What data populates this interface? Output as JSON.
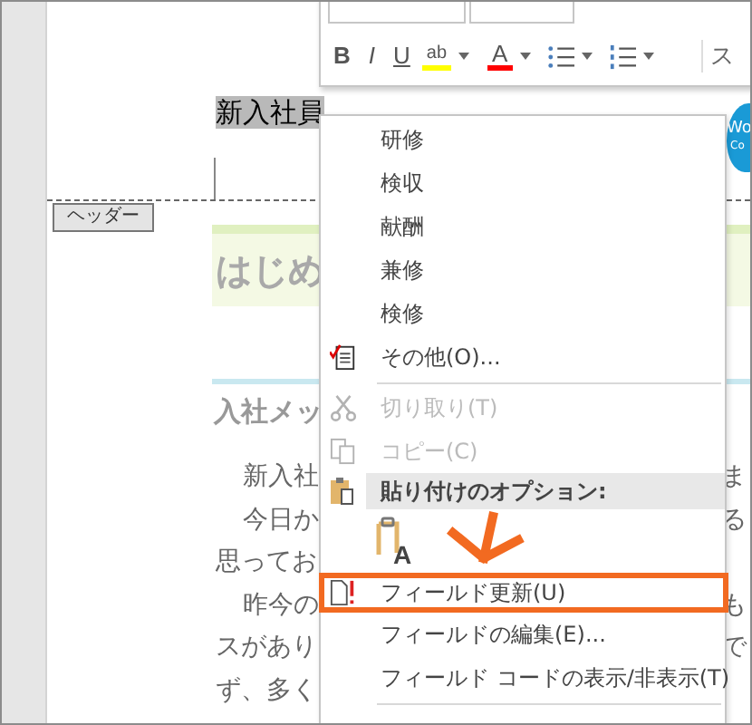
{
  "mini_toolbar": {
    "buttons": [
      {
        "kind": "bold",
        "label": "B"
      },
      {
        "kind": "italic",
        "label": "I"
      },
      {
        "kind": "underline",
        "label": "U"
      },
      {
        "kind": "highlight",
        "label": "ab"
      },
      {
        "kind": "font_color",
        "label": "A"
      },
      {
        "kind": "bullets"
      },
      {
        "kind": "numbering"
      }
    ],
    "right_text": "ス"
  },
  "document": {
    "title": [
      {
        "text": "新入社員",
        "selected": true
      }
    ],
    "header_tag": "ヘッダー",
    "banner": "はじめ",
    "section_heading": "入社メッ",
    "body_lines": [
      {
        "left": "新入社",
        "right": "ま",
        "indented": true
      },
      {
        "left": "今日か",
        "right": "る",
        "indented": true
      },
      {
        "left": "思ってお",
        "indented": false
      },
      {
        "left": "昨今の",
        "right": "も",
        "indented": true
      },
      {
        "left": "スがあり",
        "right": "で",
        "indented": false
      },
      {
        "left": "ず、多く",
        "indented": false
      }
    ],
    "side_logo": [
      "Wo",
      "Co"
    ]
  },
  "context_menu": {
    "items": [
      {
        "kind": "suggestion",
        "label": "研修",
        "disabled": false,
        "highlighted": false
      },
      {
        "kind": "suggestion",
        "label": "検収",
        "disabled": false,
        "highlighted": false
      },
      {
        "kind": "suggestion",
        "label": "献酬",
        "disabled": false,
        "highlighted": false
      },
      {
        "kind": "suggestion",
        "label": "兼修",
        "disabled": false,
        "highlighted": false
      },
      {
        "kind": "suggestion",
        "label": "検修",
        "disabled": false,
        "highlighted": false
      },
      {
        "kind": "more",
        "label": "その他(O)...",
        "disabled": false,
        "highlighted": false
      },
      {
        "kind": "separator"
      },
      {
        "kind": "cut",
        "label": "切り取り(T)",
        "disabled": true,
        "highlighted": false
      },
      {
        "kind": "copy",
        "label": "コピー(C)",
        "disabled": true,
        "highlighted": false
      },
      {
        "kind": "paste_header",
        "label": "貼り付けのオプション:"
      },
      {
        "kind": "paste_option",
        "label": "A"
      },
      {
        "kind": "update_field",
        "label": "フィールド更新(U)",
        "disabled": false,
        "highlighted": true
      },
      {
        "kind": "command",
        "label": "フィールドの編集(E)...",
        "disabled": false,
        "highlighted": false
      },
      {
        "kind": "command",
        "label": "フィールド コードの表示/非表示(T)",
        "disabled": false,
        "highlighted": false
      },
      {
        "kind": "separator"
      }
    ]
  }
}
